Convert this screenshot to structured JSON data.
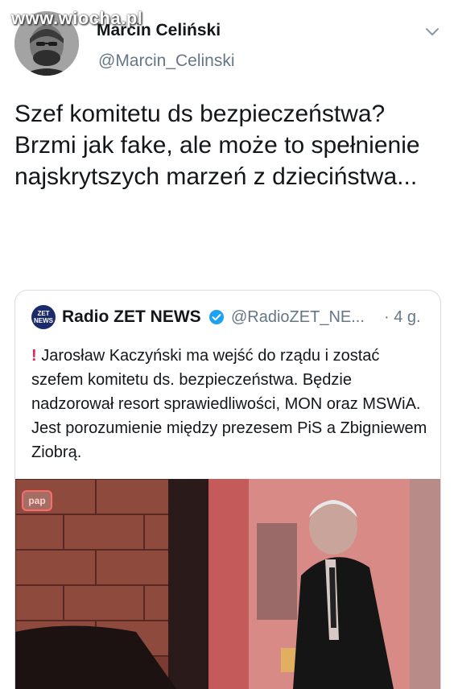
{
  "watermark": "www.wiocha.pl",
  "tweet": {
    "author_name": "Marcin Celiński",
    "author_handle": "@Marcin_Celinski",
    "text": "Szef komitetu ds bezpieczeństwa? Brzmi jak fake, ale może to spełnienie najskrytszych marzeń z dzieciństwa..."
  },
  "quoted_tweet": {
    "logo_text": "ZET NEWS",
    "author_name": "Radio ZET NEWS",
    "author_handle": "@RadioZET_NE...",
    "time": "· 4 g.",
    "alert_mark": "!",
    "text": "Jarosław Kaczyński ma wejść do rządu i zostać szefem komitetu ds. bezpieczeństwa. Będzie nadzorował resort sprawiedliwości, MON oraz MSWiA. Jest porozumienie między prezesem PiS a Zbigniewem Ziobrą.",
    "image_badge": "pap"
  },
  "icons": {
    "menu": "chevron-down-icon",
    "verified": "verified-badge-icon"
  },
  "colors": {
    "text": "#14171a",
    "muted": "#657786",
    "verified": "#1da1f2",
    "alert": "#e0245e",
    "border": "#d6dde3"
  }
}
